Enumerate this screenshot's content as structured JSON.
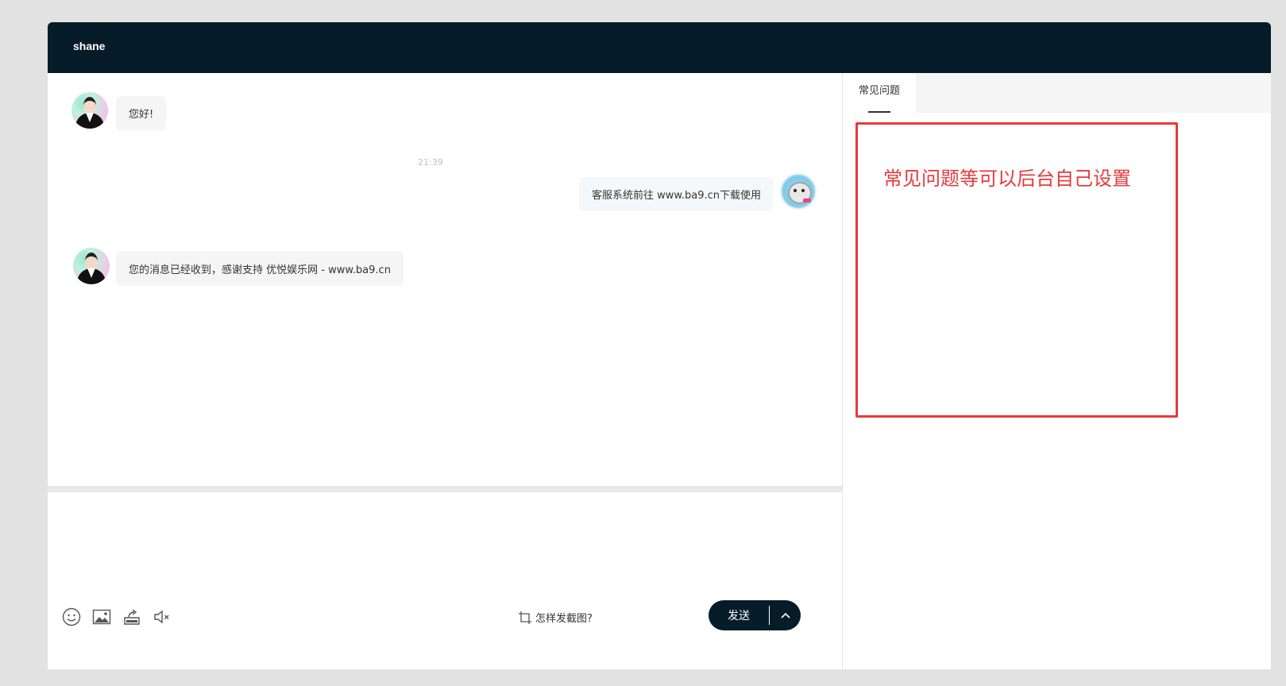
{
  "header": {
    "title": "shane"
  },
  "messages": [
    {
      "from": "agent",
      "text": "您好!"
    },
    {
      "from": "user",
      "text": "客服系统前往 www.ba9.cn下载使用"
    },
    {
      "from": "agent",
      "text": "您的消息已经收到，感谢支持 优悦娱乐网 - www.ba9.cn"
    }
  ],
  "timestamp": "21:39",
  "toolbar": {
    "icons": [
      "emoji-icon",
      "image-icon",
      "file-upload-icon",
      "mute-icon"
    ],
    "screenshot_hint": "怎样发截图?",
    "send_label": "发送"
  },
  "side": {
    "tab_label": "常见问题",
    "note": "常见问题等可以后台自己设置"
  },
  "colors": {
    "header": "#061c28",
    "accent_red": "#e8393c"
  }
}
